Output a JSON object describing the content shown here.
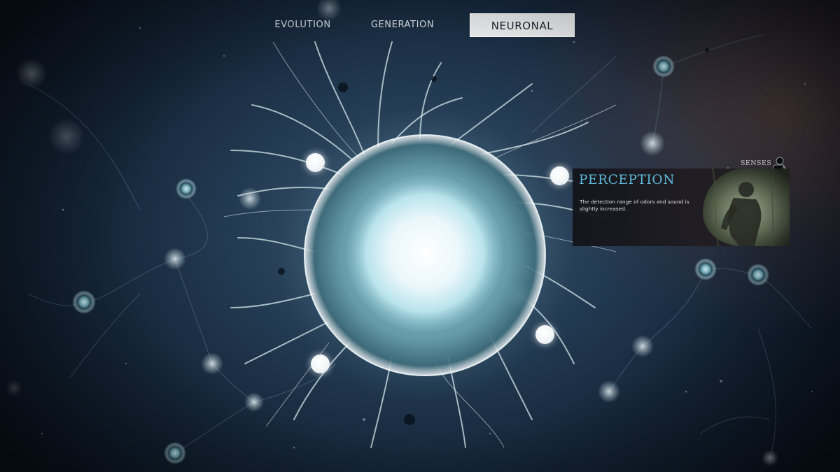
{
  "tabs": [
    {
      "label": "EVOLUTION",
      "active": false
    },
    {
      "label": "GENERATION",
      "active": false
    },
    {
      "label": "NEURONAL",
      "active": true
    }
  ],
  "skill_card": {
    "category": "SENSES",
    "category_icon": "ape-silhouette-icon",
    "title": "PERCEPTION",
    "description": "The detection range of odors and sound is slightly increased.",
    "image": "ape-in-forest-illustration"
  },
  "colors": {
    "accent_title": "#5fb7d9",
    "core_glow": "#eaf7fb",
    "active_tab_bg": "#e8e9ea"
  }
}
